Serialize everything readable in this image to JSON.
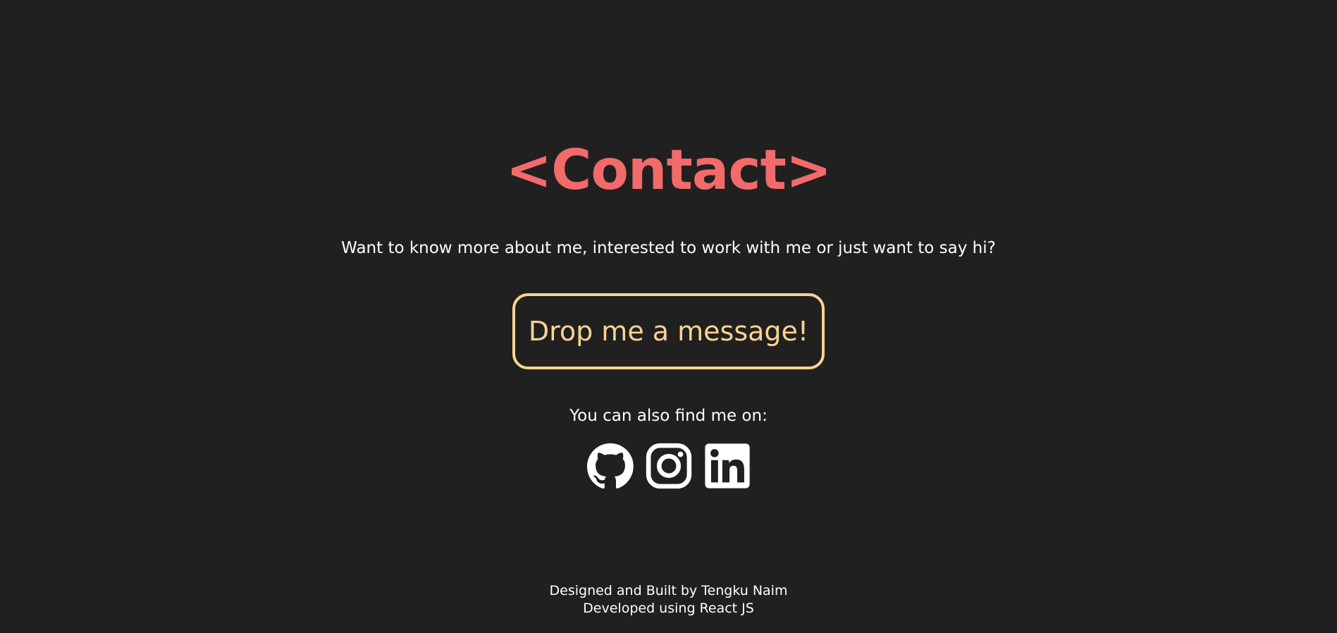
{
  "contact": {
    "title": "<Contact>",
    "intro": "Want to know more about me, interested to work with me or just want to say hi?",
    "button_label": "Drop me a message!",
    "find_me_label": "You can also find me on:"
  },
  "social": [
    {
      "icon": "github-icon",
      "label": "GitHub"
    },
    {
      "icon": "instagram-icon",
      "label": "Instagram"
    },
    {
      "icon": "linkedin-icon",
      "label": "LinkedIn"
    }
  ],
  "footer": {
    "line1": "Designed and Built by Tengku Naim",
    "line2": "Developed using React JS"
  },
  "colors": {
    "background": "#202020",
    "title": "#f26a6a",
    "button_accent": "#ffd391",
    "text": "#ffffff"
  }
}
